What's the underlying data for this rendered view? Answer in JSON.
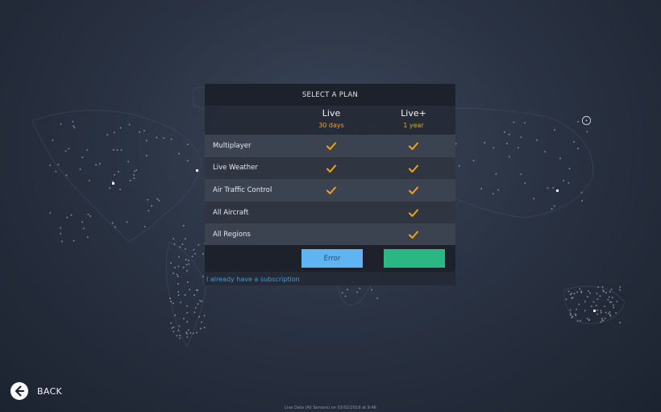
{
  "panel": {
    "title": "SELECT A PLAN",
    "plans": [
      {
        "name": "Live",
        "duration": "30 days"
      },
      {
        "name": "Live+",
        "duration": "1 year"
      }
    ],
    "features": [
      {
        "label": "Multiplayer",
        "live": true,
        "live_plus": true
      },
      {
        "label": "Live Weather",
        "live": true,
        "live_plus": true
      },
      {
        "label": "Air Traffic Control",
        "live": true,
        "live_plus": true
      },
      {
        "label": "All Aircraft",
        "live": false,
        "live_plus": true
      },
      {
        "label": "All Regions",
        "live": false,
        "live_plus": true
      }
    ],
    "buttons": {
      "live_label": "Error",
      "live_plus_label": ""
    },
    "subscription_link": "I already have a subscription"
  },
  "back": {
    "label": "BACK",
    "icon": "arrow-left-circle-icon"
  },
  "footer": {
    "text": "Live Data (All Servers) on 03/02/2019 at 9:46"
  },
  "colors": {
    "accent_orange": "#f0a21e",
    "button_blue": "#5eb5f2",
    "button_green": "#2bb783",
    "link_blue": "#4d9ad6"
  }
}
